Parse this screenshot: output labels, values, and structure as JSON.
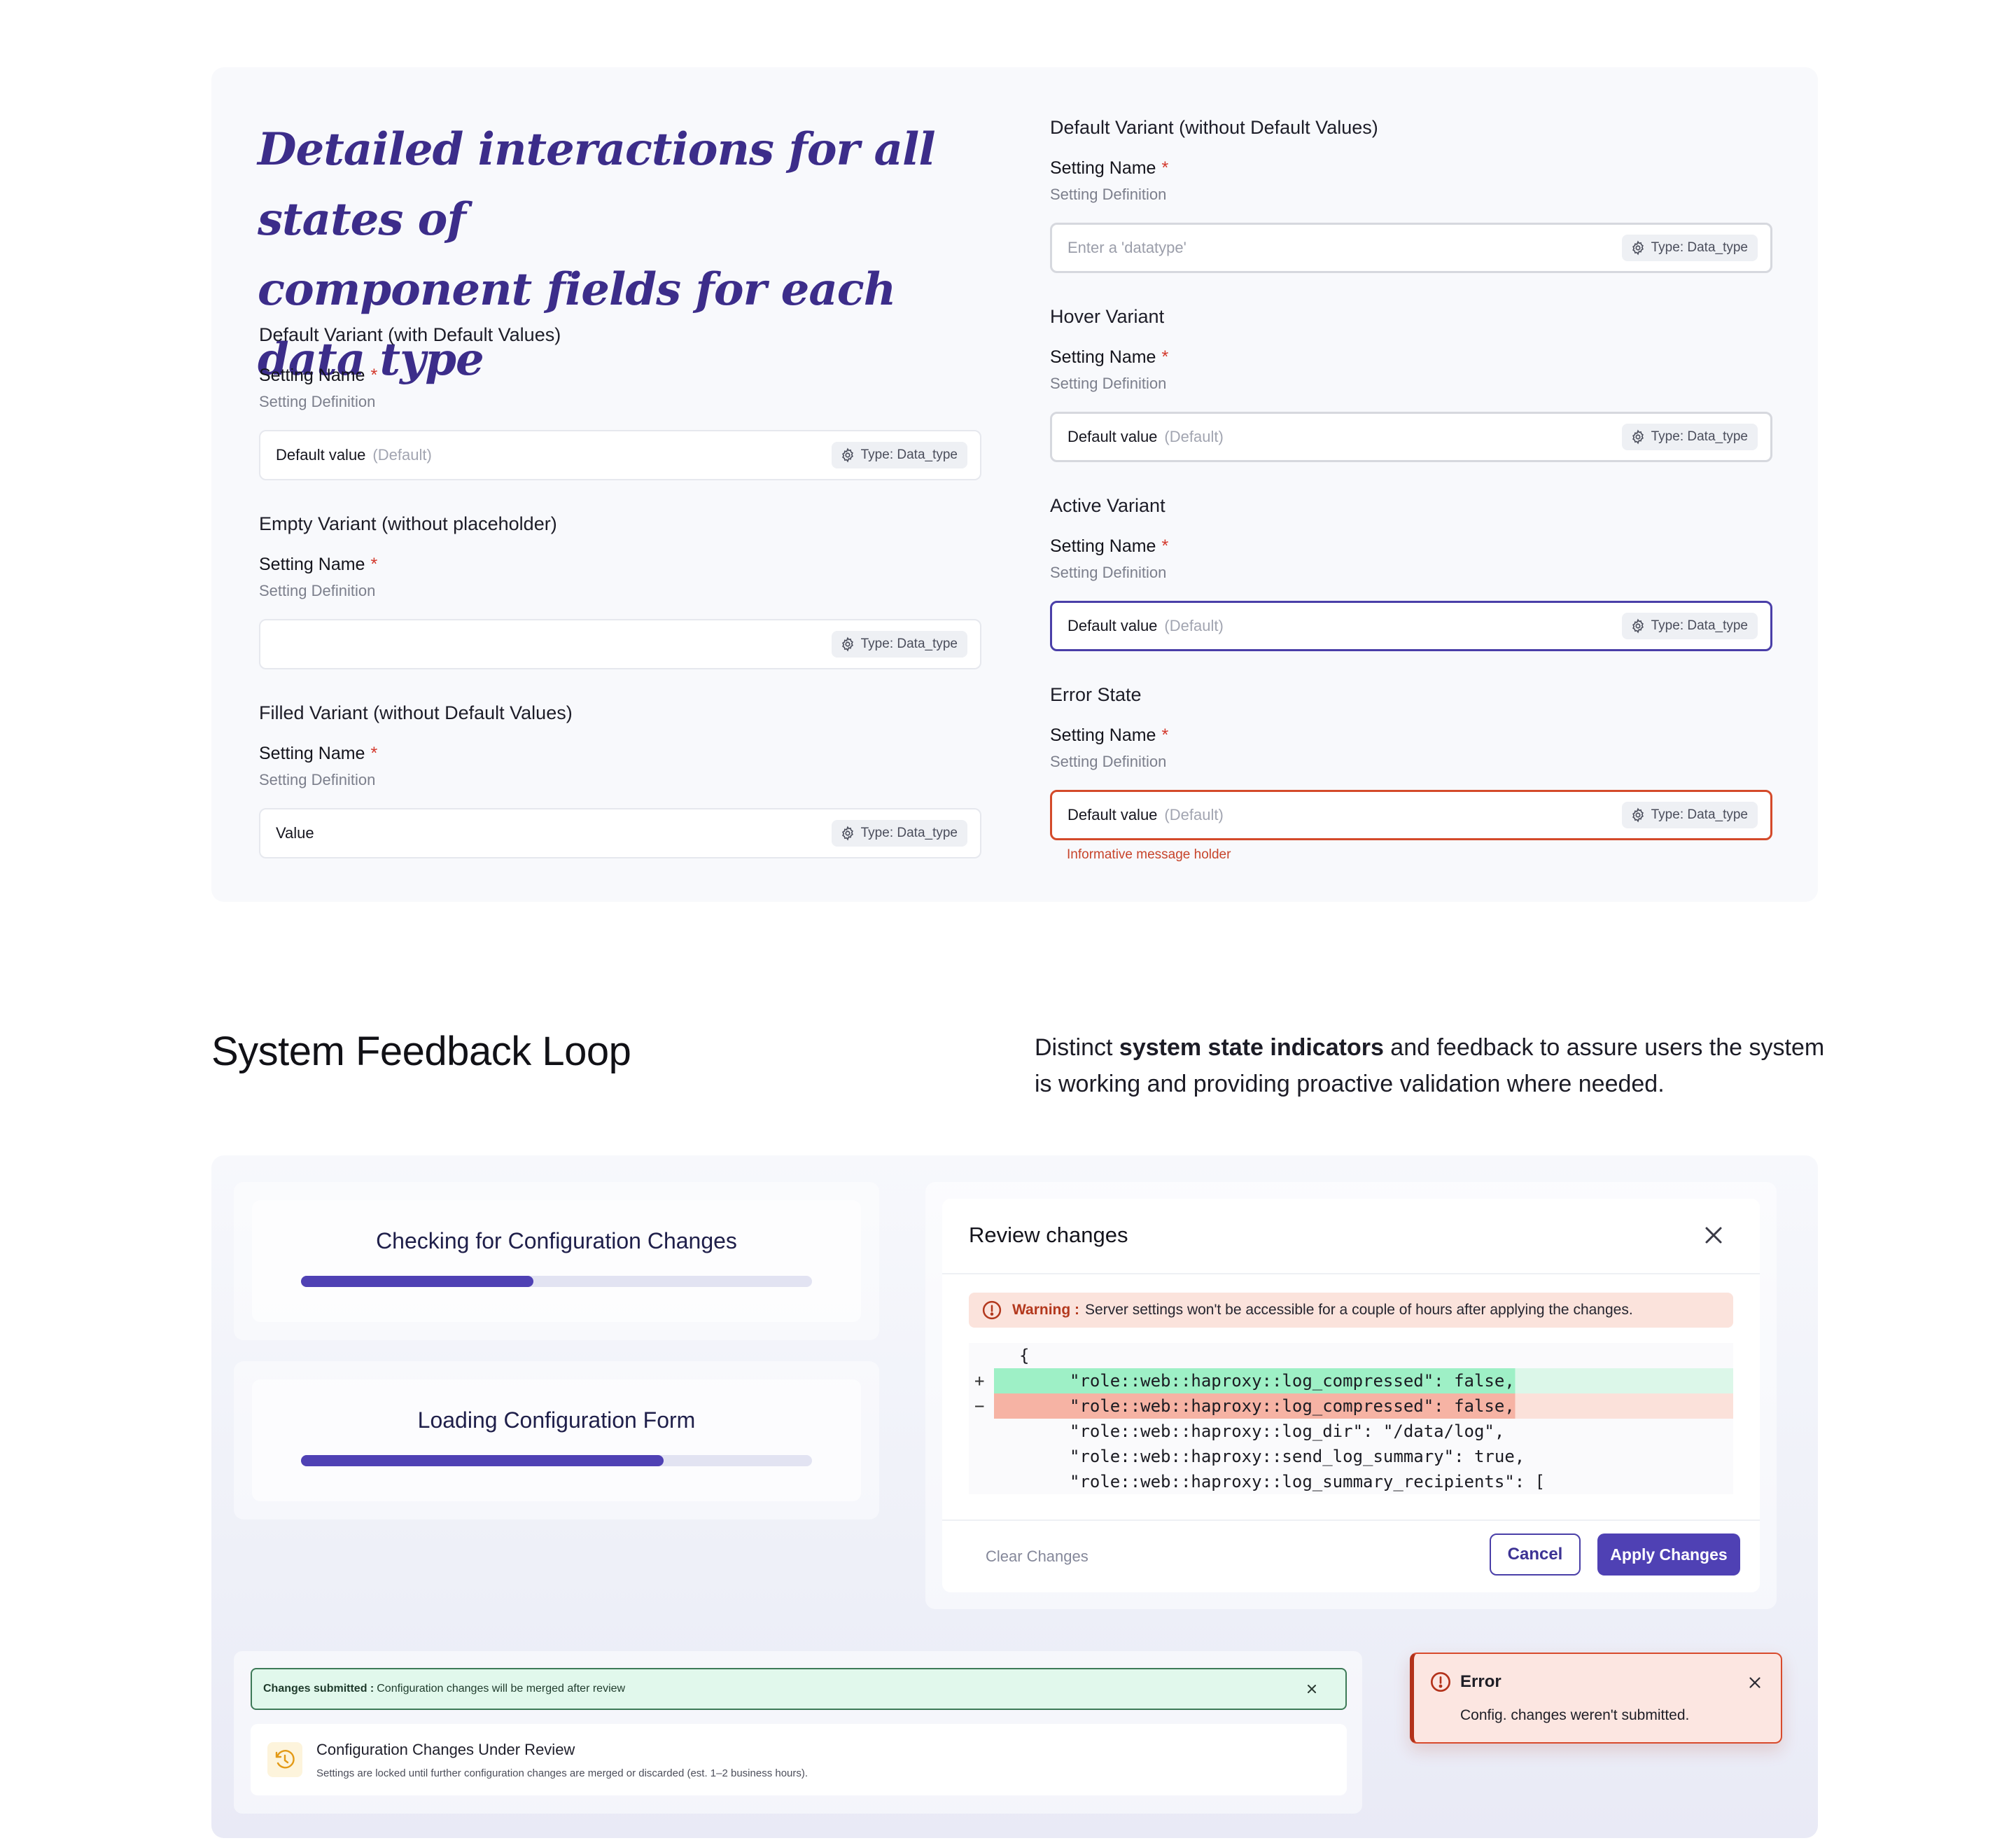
{
  "hero": {
    "line1": "Detailed interactions for all states of",
    "line2": "component fields for each data type"
  },
  "fields": {
    "default_with": {
      "variant": "Default Variant (with Default Values)",
      "name": "Setting Name",
      "required": "*",
      "definition": "Setting Definition",
      "value": "Default value",
      "default_tag": "(Default)",
      "badge": "Type: Data_type"
    },
    "empty": {
      "variant": "Empty Variant (without placeholder)",
      "name": "Setting Name",
      "required": "*",
      "definition": "Setting Definition",
      "badge": "Type: Data_type"
    },
    "filled": {
      "variant": "Filled Variant (without Default Values)",
      "name": "Setting Name",
      "required": "*",
      "definition": "Setting Definition",
      "value": "Value",
      "badge": "Type: Data_type"
    },
    "default_without": {
      "variant": "Default Variant (without Default Values)",
      "name": "Setting Name",
      "required": "*",
      "definition": "Setting Definition",
      "placeholder": "Enter a 'datatype'",
      "badge": "Type: Data_type"
    },
    "hover": {
      "variant": "Hover Variant",
      "name": "Setting Name",
      "required": "*",
      "definition": "Setting Definition",
      "value": "Default value",
      "default_tag": "(Default)",
      "badge": "Type: Data_type"
    },
    "active": {
      "variant": "Active Variant",
      "name": "Setting Name",
      "required": "*",
      "definition": "Setting Definition",
      "value": "Default value",
      "default_tag": "(Default)",
      "badge": "Type: Data_type"
    },
    "error": {
      "variant": "Error State",
      "name": "Setting Name",
      "required": "*",
      "definition": "Setting Definition",
      "value": "Default value",
      "default_tag": "(Default)",
      "badge": "Type: Data_type",
      "message": "Informative message holder"
    }
  },
  "section": {
    "title": "System Feedback Loop",
    "desc_pre": "Distinct ",
    "desc_bold": "system state indicators",
    "desc_post": " and feedback to assure users the system is working and providing proactive validation where needed."
  },
  "progress": {
    "checking": {
      "label": "Checking for Configuration Changes",
      "fraction": 0.455
    },
    "loading": {
      "label": "Loading Configuration Form",
      "fraction": 0.71
    }
  },
  "modal": {
    "title": "Review changes",
    "warning_label": "Warning :",
    "warning_text": "Server settings won't be accessible for a couple of hours after applying the changes.",
    "code": [
      {
        "mark": "",
        "kind": "plain",
        "text": "{"
      },
      {
        "mark": "+",
        "kind": "add",
        "text": "\"role::web::haproxy::log_compressed\": false,"
      },
      {
        "mark": "−",
        "kind": "del",
        "text": "\"role::web::haproxy::log_compressed\": false,"
      },
      {
        "mark": "",
        "kind": "ctx",
        "text": "\"role::web::haproxy::log_dir\": \"/data/log\","
      },
      {
        "mark": "",
        "kind": "ctx",
        "text": "\"role::web::haproxy::send_log_summary\": true,"
      },
      {
        "mark": "",
        "kind": "ctx",
        "text": "\"role::web::haproxy::log_summary_recipients\": ["
      }
    ],
    "clear_label": "Clear Changes",
    "cancel_label": "Cancel",
    "apply_label": "Apply Changes"
  },
  "submitted": {
    "toast_bold": "Changes submitted :",
    "toast_text": "Configuration changes will be merged after review",
    "review_title": "Configuration Changes Under Review",
    "review_text": "Settings are locked until further configuration changes are merged or discarded (est. 1–2 business hours)."
  },
  "error_toast": {
    "title": "Error",
    "message": "Config. changes weren't submitted."
  },
  "colors": {
    "brand": "#4f41b4",
    "hero": "#3c2d8a",
    "error": "#d44a2a",
    "success_bg": "#e1f8ec",
    "add_bg": "#9ef0c6",
    "del_bg": "#f6b3a4"
  }
}
